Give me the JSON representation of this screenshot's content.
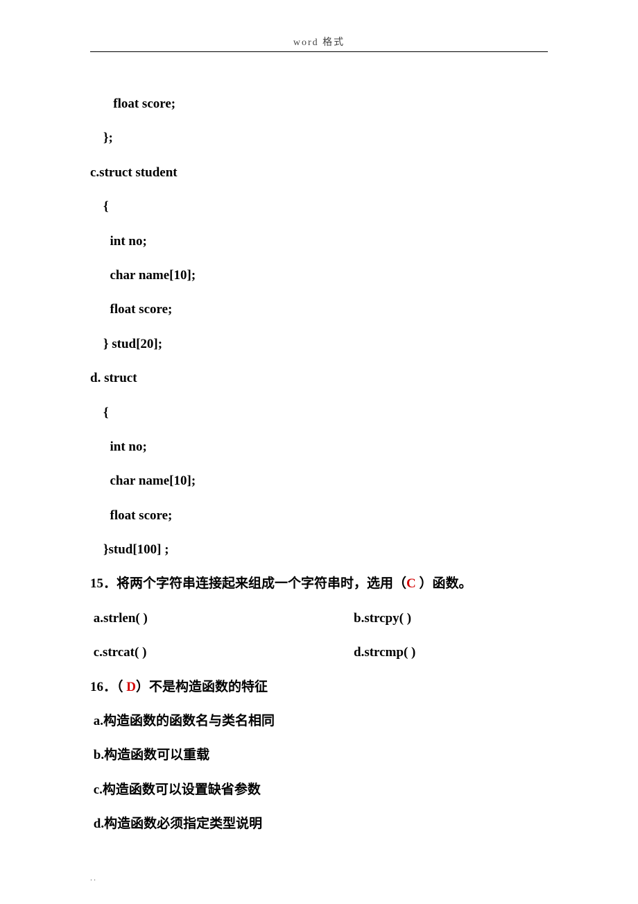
{
  "header": "word 格式",
  "lines": {
    "l1": "       float score;",
    "l2": "    };",
    "l3": "c.struct student",
    "l4": "    {",
    "l5": "      int no;",
    "l6": "      char name[10];",
    "l7": "      float score;",
    "l8": "    } stud[20];",
    "l9": "d. struct",
    "l10": "    {",
    "l11": "      int no;",
    "l12": "      char name[10];",
    "l13": "      float score;",
    "l14": "    }stud[100] ;"
  },
  "q15": {
    "prefix": "15．将两个字符串连接起来组成一个字符串时，选用（",
    "ans": "C ",
    "suffix": "）函数。",
    "a": " a.strlen( )",
    "b": "b.strcpy( )",
    "c": " c.strcat( )",
    "d": "d.strcmp( )"
  },
  "q16": {
    "prefix": "16．（ ",
    "ans": "D",
    "suffix": "）不是构造函数的特征",
    "a": " a.构造函数的函数名与类名相同",
    "b": " b.构造函数可以重载",
    "c": " c.构造函数可以设置缺省参数",
    "d": " d.构造函数必须指定类型说明"
  },
  "footer": ".."
}
